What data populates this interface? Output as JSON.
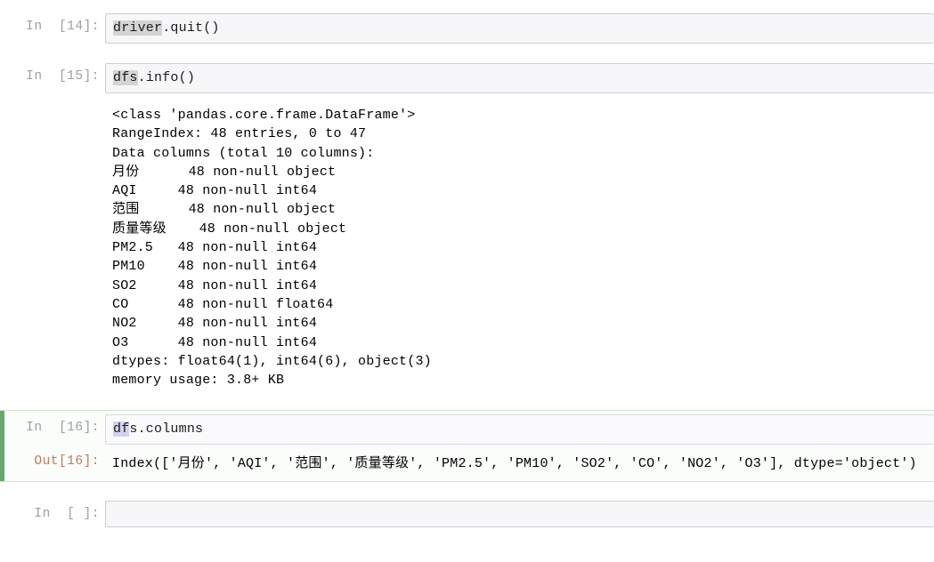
{
  "notebook": {
    "cells": [
      {
        "type": "code",
        "prompt": "In  [14]:",
        "selected": false,
        "source_prefix": "driver",
        "source_rest": ".quit()",
        "highlight": "gray"
      },
      {
        "type": "code",
        "prompt": "In  [15]:",
        "selected": false,
        "source_prefix": "dfs",
        "source_rest": ".info()",
        "highlight": "gray",
        "output_stream": "<class 'pandas.core.frame.DataFrame'>\nRangeIndex: 48 entries, 0 to 47\nData columns (total 10 columns):\n月份      48 non-null object\nAQI     48 non-null int64\n范围      48 non-null object\n质量等级    48 non-null object\nPM2.5   48 non-null int64\nPM10    48 non-null int64\nSO2     48 non-null int64\nCO      48 non-null float64\nNO2     48 non-null int64\nO3      48 non-null int64\ndtypes: float64(1), int64(6), object(3)\nmemory usage: 3.8+ KB"
      },
      {
        "type": "code",
        "prompt": "In  [16]:",
        "prompt_out": "Out[16]:",
        "selected": true,
        "source_prefix": "df",
        "source_rest": "s.columns",
        "highlight": "blue",
        "output_result": "Index(['月份', 'AQI', '范围', '质量等级', 'PM2.5', 'PM10', 'SO2', 'CO', 'NO2', 'O3'], dtype='object')"
      },
      {
        "type": "code",
        "prompt": "In  [ ]:",
        "selected": false,
        "source_prefix": "",
        "source_rest": "",
        "highlight": "none"
      }
    ]
  },
  "colors": {
    "prompt_in": "#9aa0a6",
    "prompt_out": "#c07a5c",
    "selected_bar": "#69a86d",
    "input_background": "#f7f7f9",
    "input_border": "#cfcfcf",
    "selection_gray": "#d4d4d4",
    "selection_blue": "#d3d3ef"
  }
}
